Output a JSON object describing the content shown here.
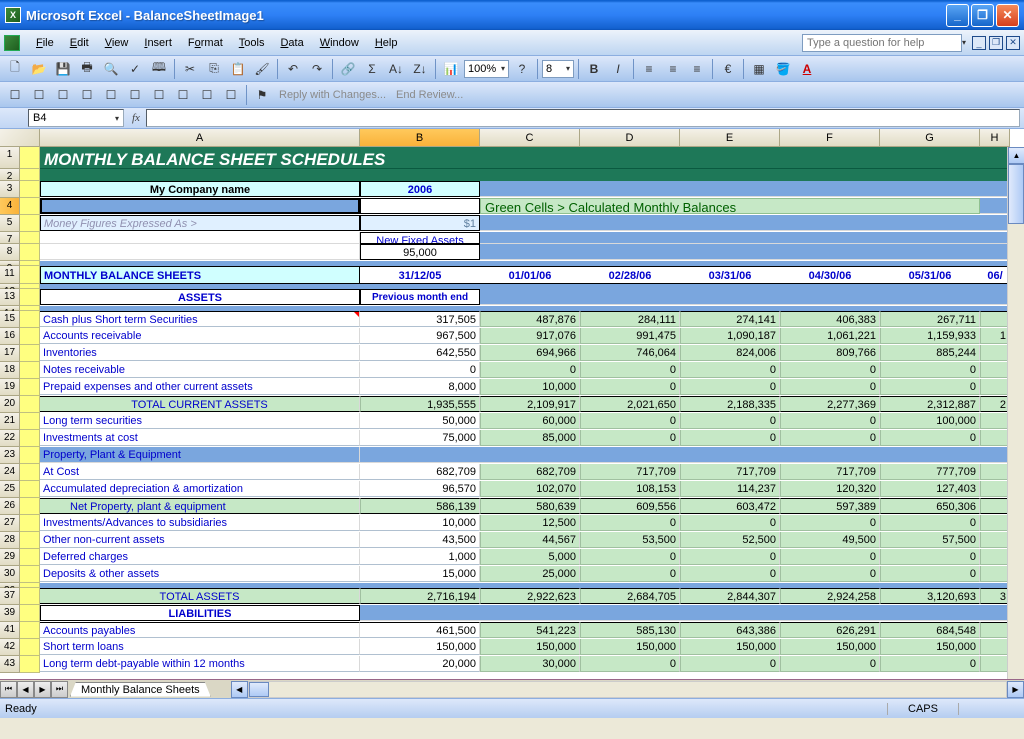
{
  "titlebar": {
    "app": "Microsoft Excel",
    "doc": "BalanceSheetImage1"
  },
  "menu": {
    "file": "File",
    "edit": "Edit",
    "view": "View",
    "insert": "Insert",
    "format": "Format",
    "tools": "Tools",
    "data": "Data",
    "window": "Window",
    "help": "Help"
  },
  "helpbox": {
    "placeholder": "Type a question for help"
  },
  "toolbar": {
    "zoom": "100%",
    "font_size": "8",
    "reply": "Reply with Changes...",
    "end_review": "End Review..."
  },
  "namebox": "B4",
  "columns": [
    "A",
    "B",
    "C",
    "D",
    "E",
    "F",
    "G",
    "H"
  ],
  "sheet": {
    "title": "MONTHLY BALANCE SHEET SCHEDULES",
    "company": "My Company name",
    "year": "2006",
    "green_note": "Green Cells > Calculated Monthly Balances",
    "money_label": "Money Figures Expressed As >",
    "money_val": "$1",
    "fixed_assets_label": "New Fixed Assets",
    "fixed_assets_val": "95,000",
    "mbs_label": "MONTHLY BALANCE SHEETS",
    "dates": [
      "31/12/05",
      "01/01/06",
      "02/28/06",
      "03/31/06",
      "04/30/06",
      "05/31/06",
      "06/"
    ],
    "prev_month_label": "Previous month end",
    "assets_header": "ASSETS",
    "liabilities_header": "LIABILITIES",
    "rows": [
      {
        "label": "Cash plus Short term Securities",
        "vals": [
          "317,505",
          "487,876",
          "284,111",
          "274,141",
          "406,383",
          "267,711",
          ""
        ]
      },
      {
        "label": "Accounts receivable",
        "vals": [
          "967,500",
          "917,076",
          "991,475",
          "1,090,187",
          "1,061,221",
          "1,159,933",
          "1"
        ]
      },
      {
        "label": "Inventories",
        "vals": [
          "642,550",
          "694,966",
          "746,064",
          "824,006",
          "809,766",
          "885,244",
          ""
        ]
      },
      {
        "label": "Notes receivable",
        "vals": [
          "0",
          "0",
          "0",
          "0",
          "0",
          "0",
          ""
        ]
      },
      {
        "label": "Prepaid expenses and other current assets",
        "vals": [
          "8,000",
          "10,000",
          "0",
          "0",
          "0",
          "0",
          ""
        ]
      }
    ],
    "total_current": {
      "label": "TOTAL CURRENT ASSETS",
      "vals": [
        "1,935,555",
        "2,109,917",
        "2,021,650",
        "2,188,335",
        "2,277,369",
        "2,312,887",
        "2"
      ]
    },
    "long_term": {
      "label": "Long term securities",
      "vals": [
        "50,000",
        "60,000",
        "0",
        "0",
        "0",
        "100,000",
        ""
      ]
    },
    "inv_cost": {
      "label": "Investments at cost",
      "vals": [
        "75,000",
        "85,000",
        "0",
        "0",
        "0",
        "0",
        ""
      ]
    },
    "ppe_header": "Property, Plant & Equipment",
    "at_cost": {
      "label": "At Cost",
      "vals": [
        "682,709",
        "682,709",
        "717,709",
        "717,709",
        "717,709",
        "777,709",
        ""
      ]
    },
    "accum_dep": {
      "label": "Accumulated depreciation & amortization",
      "vals": [
        "96,570",
        "102,070",
        "108,153",
        "114,237",
        "120,320",
        "127,403",
        ""
      ]
    },
    "net_ppe": {
      "label": "Net Property, plant & equipment",
      "vals": [
        "586,139",
        "580,639",
        "609,556",
        "603,472",
        "597,389",
        "650,306",
        ""
      ]
    },
    "inv_adv": {
      "label": "Investments/Advances to subsidiaries",
      "vals": [
        "10,000",
        "12,500",
        "0",
        "0",
        "0",
        "0",
        ""
      ]
    },
    "other_nc": {
      "label": "Other non-current assets",
      "vals": [
        "43,500",
        "44,567",
        "53,500",
        "52,500",
        "49,500",
        "57,500",
        ""
      ]
    },
    "deferred": {
      "label": "Deferred charges",
      "vals": [
        "1,000",
        "5,000",
        "0",
        "0",
        "0",
        "0",
        ""
      ]
    },
    "deposits": {
      "label": "Deposits & other assets",
      "vals": [
        "15,000",
        "25,000",
        "0",
        "0",
        "0",
        "0",
        ""
      ]
    },
    "total_assets": {
      "label": "TOTAL ASSETS",
      "vals": [
        "2,716,194",
        "2,922,623",
        "2,684,705",
        "2,844,307",
        "2,924,258",
        "3,120,693",
        "3"
      ]
    },
    "acc_pay": {
      "label": "Accounts payables",
      "vals": [
        "461,500",
        "541,223",
        "585,130",
        "643,386",
        "626,291",
        "684,548",
        ""
      ]
    },
    "short_loans": {
      "label": "Short term loans",
      "vals": [
        "150,000",
        "150,000",
        "150,000",
        "150,000",
        "150,000",
        "150,000",
        ""
      ]
    },
    "long_debt": {
      "label": "Long term debt-payable within 12 months",
      "vals": [
        "20,000",
        "30,000",
        "0",
        "0",
        "0",
        "0",
        ""
      ]
    }
  },
  "tabs": {
    "sheet1": "Monthly Balance Sheets"
  },
  "status": {
    "ready": "Ready",
    "caps": "CAPS"
  },
  "row_numbers": [
    "1",
    "2",
    "3",
    "4",
    "5",
    "7",
    "8",
    "9",
    "11",
    "12",
    "13",
    "14",
    "15",
    "16",
    "17",
    "18",
    "19",
    "20",
    "21",
    "22",
    "23",
    "24",
    "25",
    "26",
    "27",
    "28",
    "29",
    "30",
    "36",
    "37",
    "39",
    "41",
    "42",
    "43"
  ]
}
